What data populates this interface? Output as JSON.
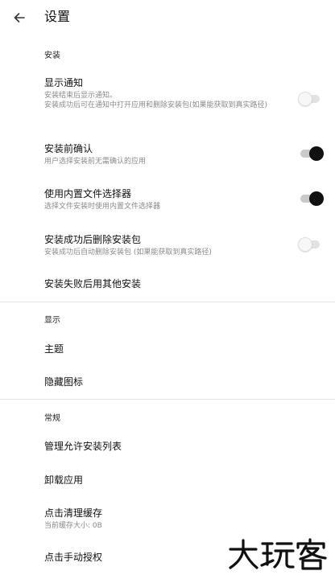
{
  "appbar": {
    "title": "设置"
  },
  "sections": {
    "install": "安装",
    "display": "显示",
    "general": "常规"
  },
  "items": {
    "show_notification": {
      "title": "显示通知",
      "summary": "安装结束后显示通知。\n安装成功后可在通知中打开应用和删除安装包(如果能获取到真实路径)",
      "switch_on": false
    },
    "confirm_before_install": {
      "title": "安装前确认",
      "summary": "用户选择安装前无需确认的应用",
      "switch_on": true
    },
    "builtin_file_picker": {
      "title": "使用内置文件选择器",
      "summary": "选择文件安装时使用内置文件选择器",
      "switch_on": true
    },
    "delete_after_install": {
      "title": "安装成功后删除安装包",
      "summary": "安装成功后自动删除安装包 (如果能获取到真实路径)",
      "switch_on": false
    },
    "use_other_installer": {
      "title": "安装失败后用其他安装"
    },
    "theme": {
      "title": "主题"
    },
    "hide_icon": {
      "title": "隐藏图标"
    },
    "manage_allowlist": {
      "title": "管理允许安装列表"
    },
    "uninstall_app": {
      "title": "卸载应用"
    },
    "clear_cache": {
      "title": "点击清理缓存",
      "summary": "当前缓存大小: 0B"
    },
    "manual_authorize": {
      "title": "点击手动授权"
    }
  },
  "watermark": {
    "text": "大玩客"
  },
  "colors": {
    "switch_on_thumb": "#111111",
    "switch_on_track": "#c9c9c9",
    "switch_off_thumb": "#f7f7f7",
    "switch_off_track": "#e2e2e2",
    "summary_text": "#8a8a8a",
    "divider": "#e3e3e3"
  },
  "icons": {
    "back": "arrow-back-icon"
  }
}
